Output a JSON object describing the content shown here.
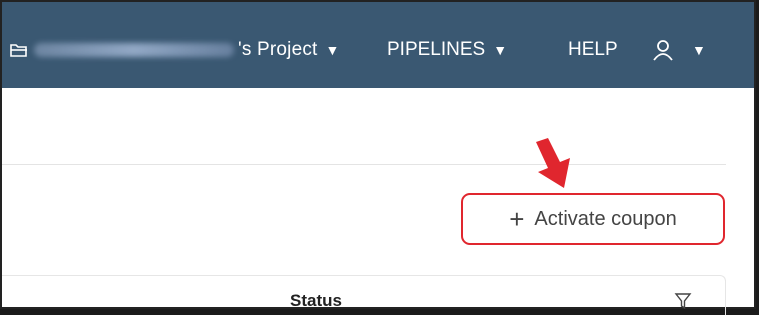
{
  "header": {
    "project_suffix": "'s Project",
    "project_caret": "▼",
    "pipelines_label": "PIPELINES",
    "pipelines_caret": "▼",
    "help_label": "HELP",
    "user_caret": "▼",
    "background_color": "#3a5872"
  },
  "actions": {
    "activate_coupon_plus": "+",
    "activate_coupon_label": "Activate coupon",
    "highlight_color": "#e0262e"
  },
  "table": {
    "column_status": "Status"
  },
  "icons": [
    "folder-icon",
    "user-icon",
    "filter-icon",
    "pointer-arrow-icon"
  ]
}
